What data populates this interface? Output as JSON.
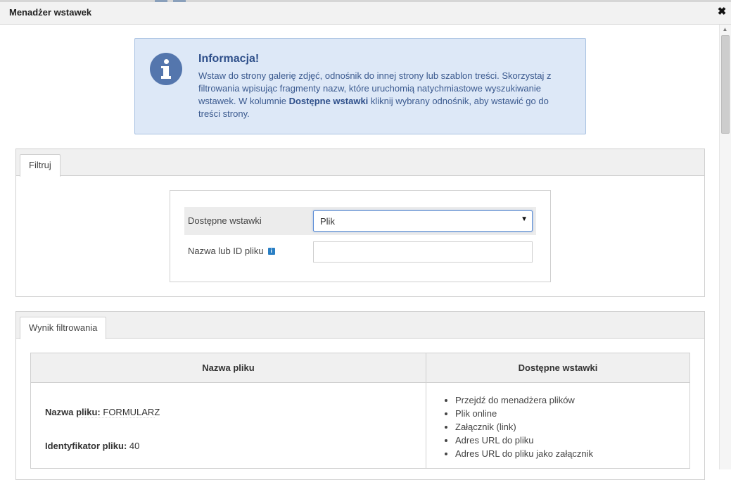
{
  "window": {
    "title": "Menadżer wstawek",
    "close_symbol": "✖"
  },
  "info": {
    "icon": "info-icon",
    "title": "Informacja!",
    "text_part1": "Wstaw do strony galerię zdjęć, odnośnik do innej strony lub szablon treści. Skorzystaj z filtrowania wpisując fragmenty nazw, które uruchomią natychmiastowe wyszukiwanie wstawek. W kolumnie ",
    "text_bold": "Dostępne wstawki",
    "text_part2": " kliknij wybrany odnośnik, aby wstawić go do treści strony."
  },
  "filter": {
    "tab_label": "Filtruj",
    "available_label": "Dostępne wstawki",
    "available_value": "Plik",
    "name_label": "Nazwa lub ID pliku",
    "name_value": "",
    "help_symbol": "i"
  },
  "results": {
    "tab_label": "Wynik filtrowania",
    "col_name": "Nazwa pliku",
    "col_actions": "Dostępne wstawki",
    "rows": [
      {
        "name_label": "Nazwa pliku:",
        "name_value": "FORMULARZ",
        "id_label": "Identyfikator pliku:",
        "id_value": "40",
        "actions": [
          "Przejdź do menadżera plików",
          "Plik online",
          "Załącznik (link)",
          "Adres URL do pliku",
          "Adres URL do pliku jako załącznik"
        ]
      }
    ]
  },
  "scrollbar": {
    "up_symbol": "▲"
  }
}
